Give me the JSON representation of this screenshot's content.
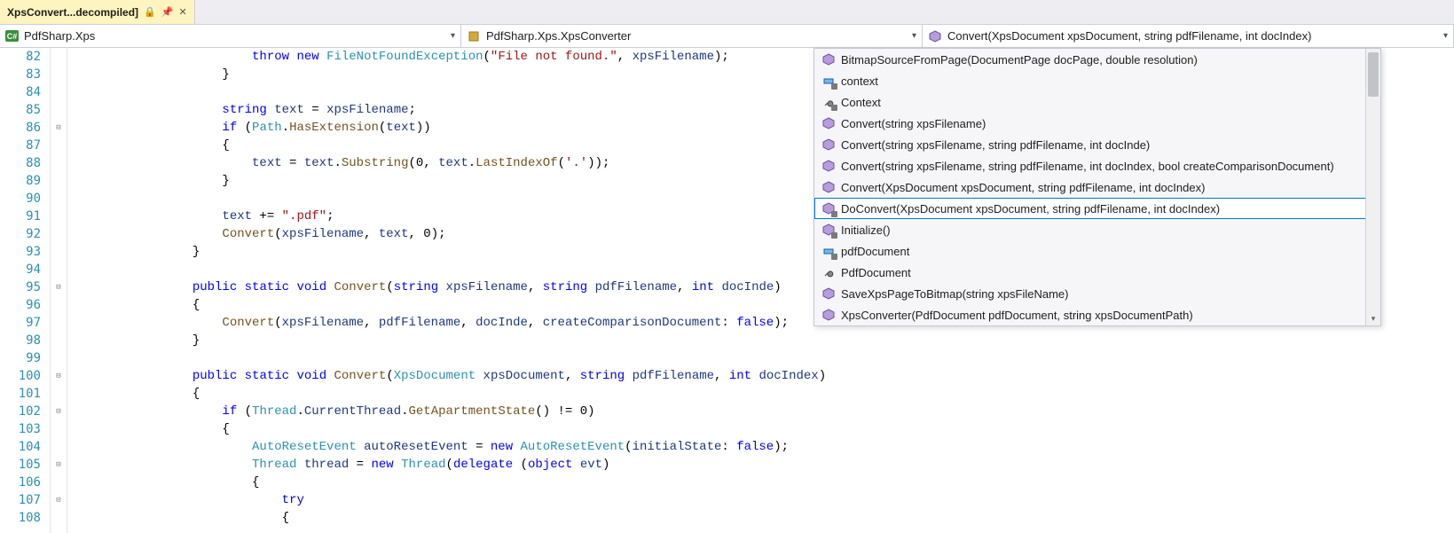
{
  "tab": {
    "title": "XpsConvert...decompiled]",
    "lock_glyph": "🔒",
    "pin_glyph": "📌",
    "close_glyph": "✕"
  },
  "nav": {
    "namespace": {
      "icon": "C#",
      "label": "PdfSharp.Xps"
    },
    "class": {
      "label": "PdfSharp.Xps.XpsConverter"
    },
    "member": {
      "label": "Convert(XpsDocument xpsDocument, string pdfFilename, int docIndex)"
    },
    "chevron": "▾"
  },
  "line_start": 82,
  "fold_markers": {
    "86": "⊟",
    "95": "⊟",
    "100": "⊟",
    "102": "⊟",
    "105": "⊟",
    "107": "⊟"
  },
  "tokens": [
    [
      [
        "                    ",
        "plain"
      ],
      [
        "throw",
        "kw"
      ],
      [
        " ",
        "plain"
      ],
      [
        "new",
        "kw"
      ],
      [
        " ",
        "plain"
      ],
      [
        "FileNotFoundException",
        "type"
      ],
      [
        "(",
        "punc"
      ],
      [
        "\"File not found.\"",
        "str"
      ],
      [
        ", ",
        "punc"
      ],
      [
        "xpsFilename",
        "param"
      ],
      [
        ");",
        "punc"
      ]
    ],
    [
      [
        "                }",
        "punc"
      ]
    ],
    [
      [
        "",
        "plain"
      ]
    ],
    [
      [
        "                ",
        "plain"
      ],
      [
        "string",
        "kw"
      ],
      [
        " ",
        "plain"
      ],
      [
        "text",
        "param"
      ],
      [
        " = ",
        "punc"
      ],
      [
        "xpsFilename",
        "param"
      ],
      [
        ";",
        "punc"
      ]
    ],
    [
      [
        "                ",
        "plain"
      ],
      [
        "if",
        "kw"
      ],
      [
        " (",
        "punc"
      ],
      [
        "Path",
        "type"
      ],
      [
        ".",
        "punc"
      ],
      [
        "HasExtension",
        "mtd"
      ],
      [
        "(",
        "punc"
      ],
      [
        "text",
        "param"
      ],
      [
        "))",
        "punc"
      ]
    ],
    [
      [
        "                {",
        "punc"
      ]
    ],
    [
      [
        "                    ",
        "plain"
      ],
      [
        "text",
        "param"
      ],
      [
        " = ",
        "punc"
      ],
      [
        "text",
        "param"
      ],
      [
        ".",
        "punc"
      ],
      [
        "Substring",
        "mtd"
      ],
      [
        "(",
        "punc"
      ],
      [
        "0",
        "num"
      ],
      [
        ", ",
        "punc"
      ],
      [
        "text",
        "param"
      ],
      [
        ".",
        "punc"
      ],
      [
        "LastIndexOf",
        "mtd"
      ],
      [
        "(",
        "punc"
      ],
      [
        "'.'",
        "str"
      ],
      [
        "));",
        "punc"
      ]
    ],
    [
      [
        "                }",
        "punc"
      ]
    ],
    [
      [
        "",
        "plain"
      ]
    ],
    [
      [
        "                ",
        "plain"
      ],
      [
        "text",
        "param"
      ],
      [
        " += ",
        "punc"
      ],
      [
        "\".pdf\"",
        "str"
      ],
      [
        ";",
        "punc"
      ]
    ],
    [
      [
        "                ",
        "plain"
      ],
      [
        "Convert",
        "mtd"
      ],
      [
        "(",
        "punc"
      ],
      [
        "xpsFilename",
        "param"
      ],
      [
        ", ",
        "punc"
      ],
      [
        "text",
        "param"
      ],
      [
        ", ",
        "punc"
      ],
      [
        "0",
        "num"
      ],
      [
        ");",
        "punc"
      ]
    ],
    [
      [
        "            }",
        "punc"
      ]
    ],
    [
      [
        "",
        "plain"
      ]
    ],
    [
      [
        "            ",
        "plain"
      ],
      [
        "public",
        "kw"
      ],
      [
        " ",
        "plain"
      ],
      [
        "static",
        "kw"
      ],
      [
        " ",
        "plain"
      ],
      [
        "void",
        "kw"
      ],
      [
        " ",
        "plain"
      ],
      [
        "Convert",
        "mtd"
      ],
      [
        "(",
        "punc"
      ],
      [
        "string",
        "kw"
      ],
      [
        " ",
        "plain"
      ],
      [
        "xpsFilename",
        "param"
      ],
      [
        ", ",
        "punc"
      ],
      [
        "string",
        "kw"
      ],
      [
        " ",
        "plain"
      ],
      [
        "pdfFilename",
        "param"
      ],
      [
        ", ",
        "punc"
      ],
      [
        "int",
        "kw"
      ],
      [
        " ",
        "plain"
      ],
      [
        "docInde",
        "param"
      ],
      [
        ")",
        "punc"
      ]
    ],
    [
      [
        "            {",
        "punc"
      ]
    ],
    [
      [
        "                ",
        "plain"
      ],
      [
        "Convert",
        "mtd"
      ],
      [
        "(",
        "punc"
      ],
      [
        "xpsFilename",
        "param"
      ],
      [
        ", ",
        "punc"
      ],
      [
        "pdfFilename",
        "param"
      ],
      [
        ", ",
        "punc"
      ],
      [
        "docInde",
        "param"
      ],
      [
        ", ",
        "punc"
      ],
      [
        "createComparisonDocument",
        "param"
      ],
      [
        ": ",
        "punc"
      ],
      [
        "false",
        "kw"
      ],
      [
        ");",
        "punc"
      ]
    ],
    [
      [
        "            }",
        "punc"
      ]
    ],
    [
      [
        "",
        "plain"
      ]
    ],
    [
      [
        "            ",
        "plain"
      ],
      [
        "public",
        "kw"
      ],
      [
        " ",
        "plain"
      ],
      [
        "static",
        "kw"
      ],
      [
        " ",
        "plain"
      ],
      [
        "void",
        "kw"
      ],
      [
        " ",
        "plain"
      ],
      [
        "Convert",
        "mtd"
      ],
      [
        "(",
        "punc"
      ],
      [
        "XpsDocument",
        "type"
      ],
      [
        " ",
        "plain"
      ],
      [
        "xpsDocument",
        "param"
      ],
      [
        ", ",
        "punc"
      ],
      [
        "string",
        "kw"
      ],
      [
        " ",
        "plain"
      ],
      [
        "pdfFilename",
        "param"
      ],
      [
        ", ",
        "punc"
      ],
      [
        "int",
        "kw"
      ],
      [
        " ",
        "plain"
      ],
      [
        "docIndex",
        "param"
      ],
      [
        ")",
        "punc"
      ]
    ],
    [
      [
        "            {",
        "punc"
      ]
    ],
    [
      [
        "                ",
        "plain"
      ],
      [
        "if",
        "kw"
      ],
      [
        " (",
        "punc"
      ],
      [
        "Thread",
        "type"
      ],
      [
        ".",
        "punc"
      ],
      [
        "CurrentThread",
        "param"
      ],
      [
        ".",
        "punc"
      ],
      [
        "GetApartmentState",
        "mtd"
      ],
      [
        "() != ",
        "punc"
      ],
      [
        "0",
        "num"
      ],
      [
        ")",
        "punc"
      ]
    ],
    [
      [
        "                {",
        "punc"
      ]
    ],
    [
      [
        "                    ",
        "plain"
      ],
      [
        "AutoResetEvent",
        "type"
      ],
      [
        " ",
        "plain"
      ],
      [
        "autoResetEvent",
        "param"
      ],
      [
        " = ",
        "punc"
      ],
      [
        "new",
        "kw"
      ],
      [
        " ",
        "plain"
      ],
      [
        "AutoResetEvent",
        "type"
      ],
      [
        "(",
        "punc"
      ],
      [
        "initialState",
        "param"
      ],
      [
        ": ",
        "punc"
      ],
      [
        "false",
        "kw"
      ],
      [
        ");",
        "punc"
      ]
    ],
    [
      [
        "                    ",
        "plain"
      ],
      [
        "Thread",
        "type"
      ],
      [
        " ",
        "plain"
      ],
      [
        "thread",
        "param"
      ],
      [
        " = ",
        "punc"
      ],
      [
        "new",
        "kw"
      ],
      [
        " ",
        "plain"
      ],
      [
        "Thread",
        "type"
      ],
      [
        "(",
        "punc"
      ],
      [
        "delegate",
        "kw"
      ],
      [
        " (",
        "punc"
      ],
      [
        "object",
        "kw"
      ],
      [
        " ",
        "plain"
      ],
      [
        "evt",
        "param"
      ],
      [
        ")",
        "punc"
      ]
    ],
    [
      [
        "                    {",
        "punc"
      ]
    ],
    [
      [
        "                        ",
        "plain"
      ],
      [
        "try",
        "kw"
      ]
    ],
    [
      [
        "                        {",
        "punc"
      ]
    ]
  ],
  "popup": {
    "selected_index": 7,
    "items": [
      {
        "icon": "cube",
        "label": "BitmapSourceFromPage(DocumentPage docPage, double resolution)"
      },
      {
        "icon": "field-lock",
        "label": "context"
      },
      {
        "icon": "wrench-lock",
        "label": "Context"
      },
      {
        "icon": "cube",
        "label": "Convert(string xpsFilename)"
      },
      {
        "icon": "cube",
        "label": "Convert(string xpsFilename, string pdfFilename, int docInde)"
      },
      {
        "icon": "cube",
        "label": "Convert(string xpsFilename, string pdfFilename, int docIndex, bool createComparisonDocument)"
      },
      {
        "icon": "cube",
        "label": "Convert(XpsDocument xpsDocument, string pdfFilename, int docIndex)"
      },
      {
        "icon": "cube-lock",
        "label": "DoConvert(XpsDocument xpsDocument, string pdfFilename, int docIndex)"
      },
      {
        "icon": "cube-lock",
        "label": "Initialize()"
      },
      {
        "icon": "field-lock",
        "label": "pdfDocument"
      },
      {
        "icon": "wrench",
        "label": "PdfDocument"
      },
      {
        "icon": "cube",
        "label": "SaveXpsPageToBitmap(string xpsFileName)"
      },
      {
        "icon": "cube",
        "label": "XpsConverter(PdfDocument pdfDocument, string xpsDocumentPath)"
      }
    ]
  }
}
